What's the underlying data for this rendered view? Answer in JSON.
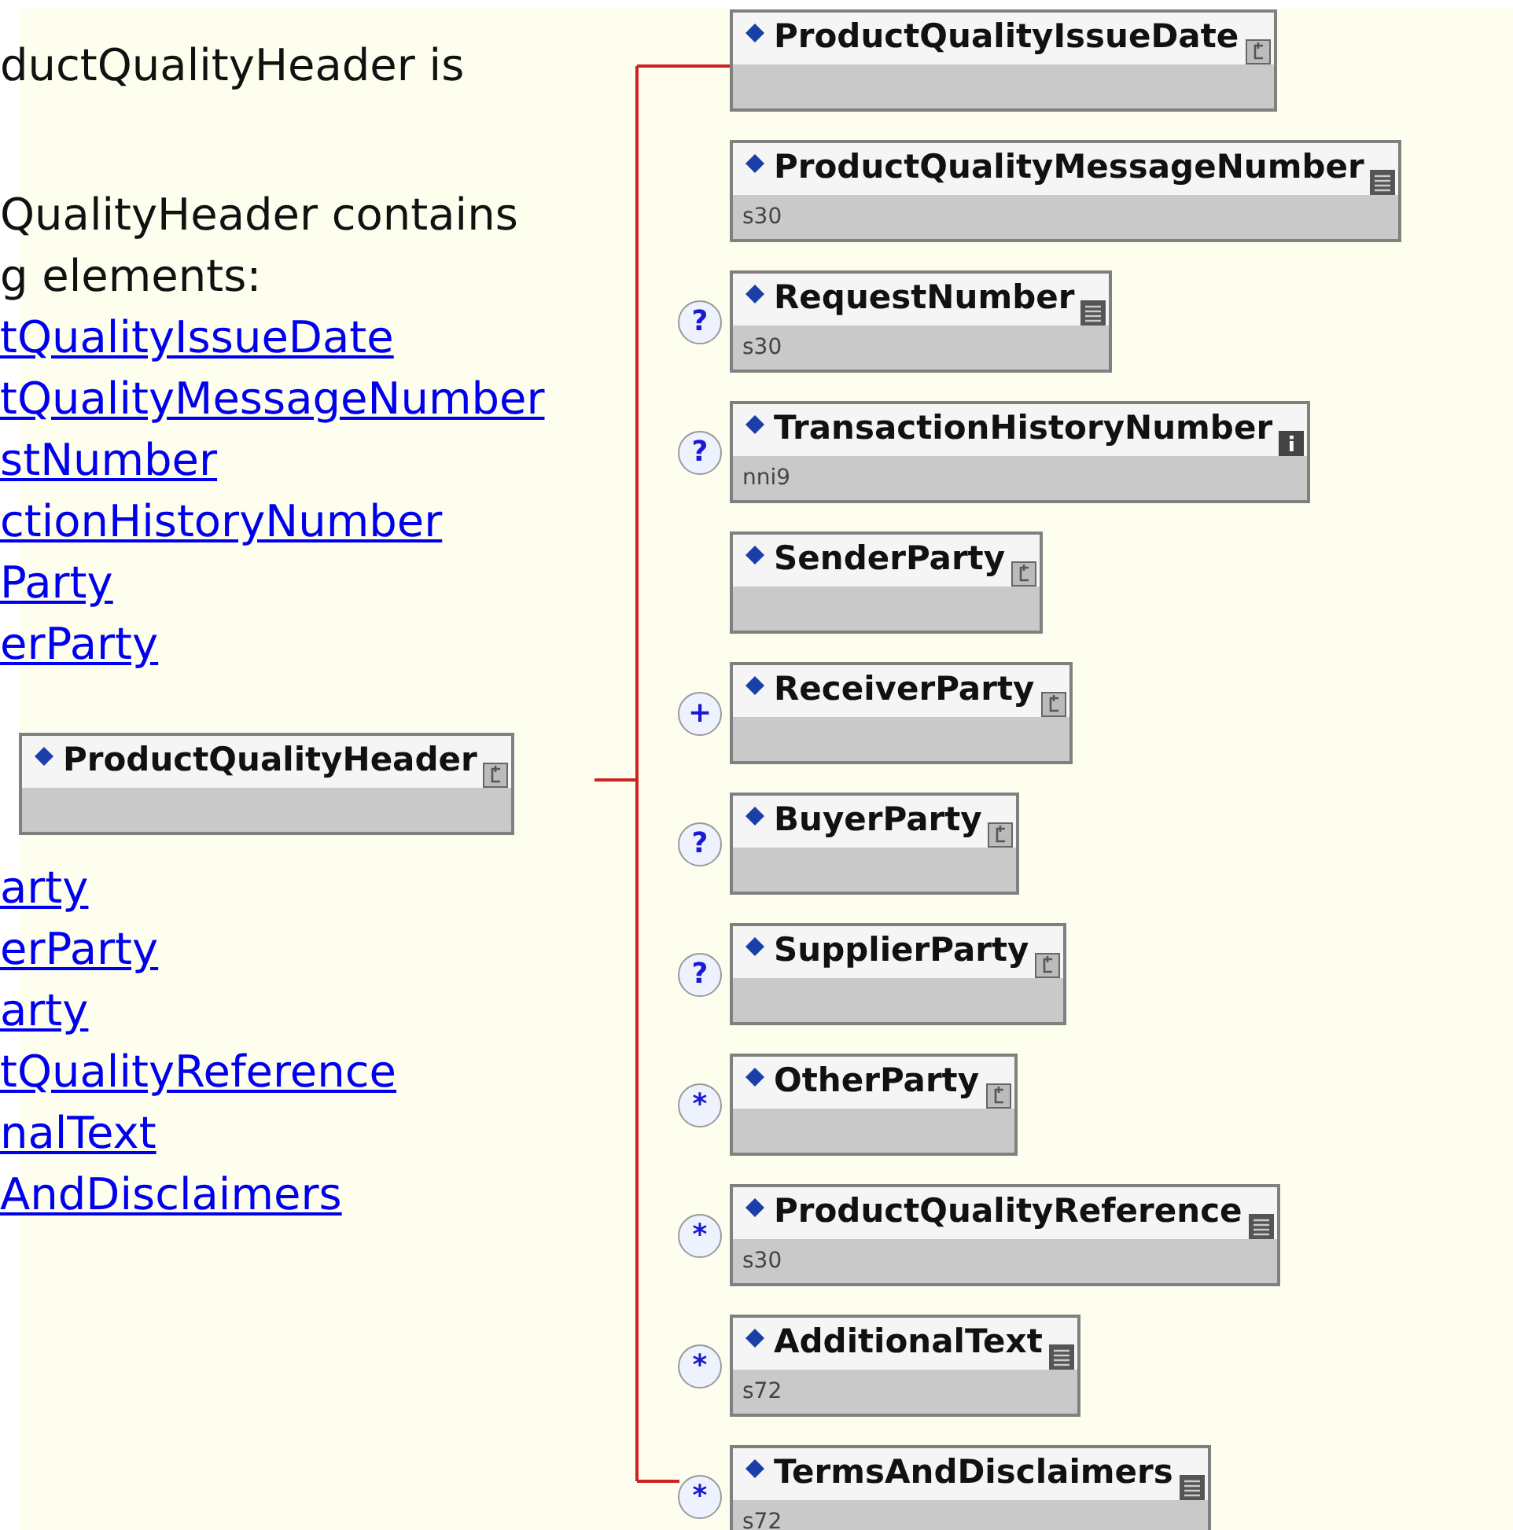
{
  "description": {
    "intro": "ductQualityHeader is",
    "contains": "QualityHeader contains g elements:",
    "links_above": [
      "tQualityIssueDate",
      "tQualityMessageNumber",
      "stNumber",
      "ctionHistoryNumber",
      "Party",
      "erParty"
    ],
    "links_below": [
      "arty",
      "erParty",
      "arty",
      "tQualityReference",
      "nalText",
      "AndDisclaimers"
    ]
  },
  "diagram": {
    "root": {
      "name": "ProductQualityHeader",
      "kind": "complex"
    },
    "children": [
      {
        "name": "ProductQualityIssueDate",
        "kind": "complex"
      },
      {
        "name": "ProductQualityMessageNumber",
        "type": "s30",
        "kind": "simple"
      },
      {
        "name": "RequestNumber",
        "type": "s30",
        "kind": "simple",
        "marker": "?"
      },
      {
        "name": "TransactionHistoryNumber",
        "type": "nni9",
        "kind": "info",
        "marker": "?"
      },
      {
        "name": "SenderParty",
        "kind": "complex"
      },
      {
        "name": "ReceiverParty",
        "kind": "complex",
        "marker": "+"
      },
      {
        "name": "BuyerParty",
        "kind": "complex",
        "marker": "?"
      },
      {
        "name": "SupplierParty",
        "kind": "complex",
        "marker": "?"
      },
      {
        "name": "OtherParty",
        "kind": "complex",
        "marker": "*"
      },
      {
        "name": "ProductQualityReference",
        "type": "s30",
        "kind": "simple",
        "marker": "*"
      },
      {
        "name": "AdditionalText",
        "type": "s72",
        "kind": "simple",
        "marker": "*"
      },
      {
        "name": "TermsAndDisclaimers",
        "type": "s72",
        "kind": "simple",
        "marker": "*"
      }
    ]
  }
}
